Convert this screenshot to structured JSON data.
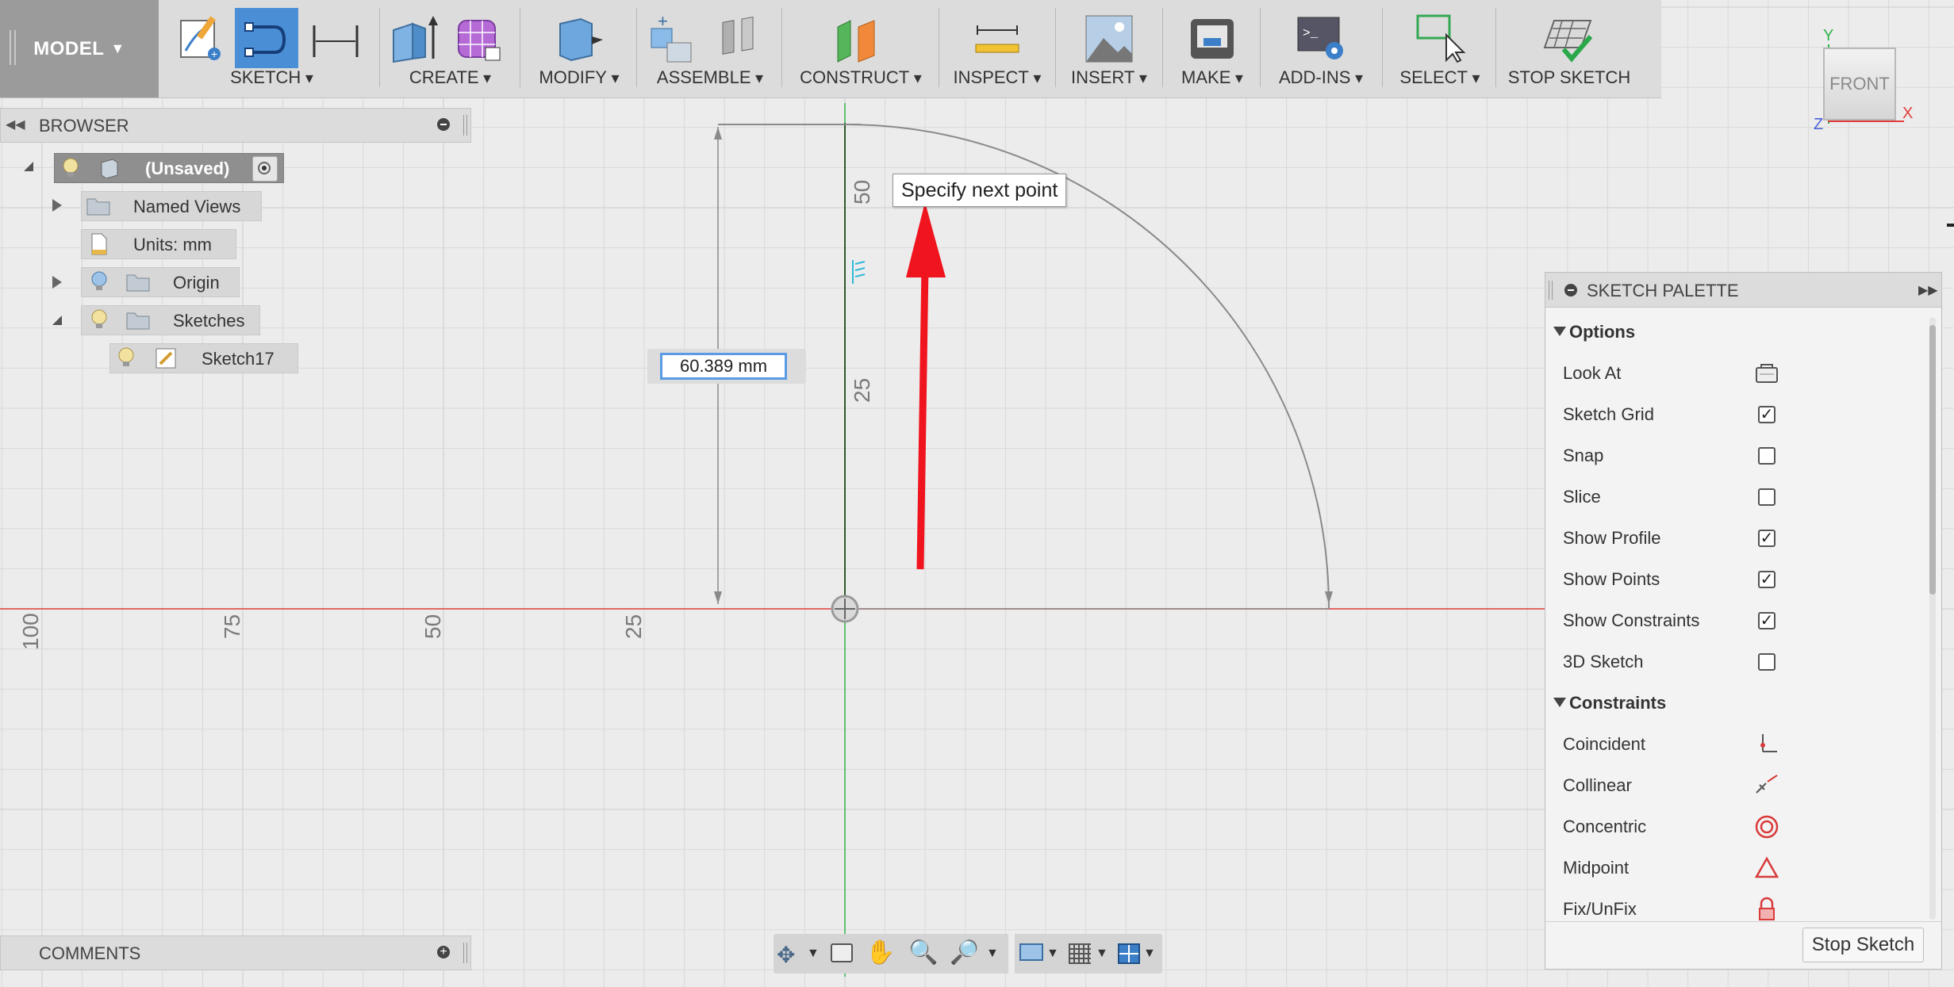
{
  "toolbar": {
    "workspace": "MODEL",
    "groups": [
      "SKETCH",
      "CREATE",
      "MODIFY",
      "ASSEMBLE",
      "CONSTRUCT",
      "INSPECT",
      "INSERT",
      "MAKE",
      "ADD-INS",
      "SELECT",
      "STOP SKETCH"
    ]
  },
  "browser": {
    "title": "BROWSER",
    "root": "(Unsaved)",
    "items": [
      "Named Views",
      "Units: mm",
      "Origin",
      "Sketches",
      "Sketch17"
    ]
  },
  "comments": {
    "title": "COMMENTS"
  },
  "canvas": {
    "tooltip": "Specify next point",
    "dimension_value": "60.389 mm",
    "ruler_h": [
      "100",
      "75",
      "50",
      "25"
    ],
    "ruler_v": [
      "50",
      "25"
    ]
  },
  "palette": {
    "title": "SKETCH PALETTE",
    "options_header": "Options",
    "options": [
      {
        "label": "Look At",
        "type": "button"
      },
      {
        "label": "Sketch Grid",
        "checked": true
      },
      {
        "label": "Snap",
        "checked": false
      },
      {
        "label": "Slice",
        "checked": false
      },
      {
        "label": "Show Profile",
        "checked": true
      },
      {
        "label": "Show Points",
        "checked": true
      },
      {
        "label": "Show Constraints",
        "checked": true
      },
      {
        "label": "3D Sketch",
        "checked": false
      }
    ],
    "constraints_header": "Constraints",
    "constraints": [
      "Coincident",
      "Collinear",
      "Concentric",
      "Midpoint",
      "Fix/UnFix"
    ],
    "stop_button": "Stop Sketch"
  },
  "viewcube": {
    "face": "FRONT",
    "axes": [
      "Y",
      "X",
      "Z"
    ]
  },
  "colors": {
    "x_axis": "#e23b3b",
    "y_axis": "#2fb34a",
    "arrow": "#f0141e",
    "selection": "#4a8fd6"
  }
}
